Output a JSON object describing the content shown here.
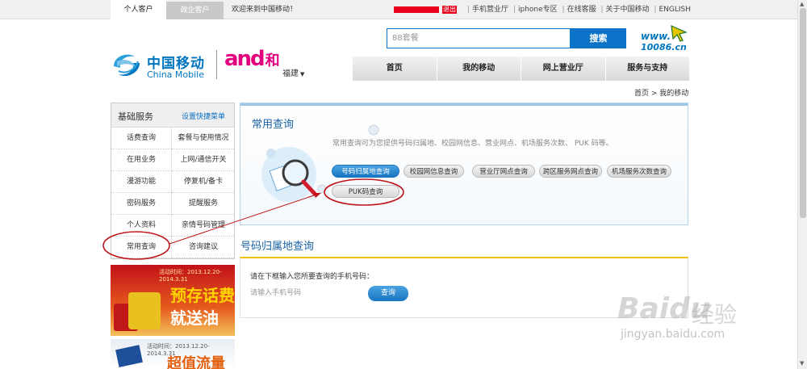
{
  "topbar": {
    "tab_personal": "个人客户",
    "tab_enterprise": "政企客户",
    "welcome": "欢迎来到中国移动！",
    "logout": "退出",
    "links": [
      "手机营业厅",
      "iphone专区",
      "在线客服",
      "关于中国移动",
      "ENGLISH"
    ]
  },
  "header": {
    "brand_cn": "中国移动",
    "brand_en": "China Mobile",
    "and_logo": "and",
    "and_he": "和",
    "region": "福建",
    "search_placeholder": "88套餐",
    "search_button": "搜索",
    "site_www": "www.",
    "site_num": "10086.cn"
  },
  "nav": [
    "首页",
    "我的移动",
    "网上营业厅",
    "服务与支持"
  ],
  "breadcrumb": "首页 > 我的移动",
  "sidebar": {
    "title": "基础服务",
    "set_shortcut": "设置快捷菜单",
    "items": [
      "话费查询",
      "套餐与使用情况",
      "在用业务",
      "上网/通信开关",
      "漫游功能",
      "停复机/备卡",
      "密码服务",
      "提醒服务",
      "个人资料",
      "亲情号码管理",
      "常用查询",
      "咨询建议"
    ]
  },
  "ads": {
    "ad1_date": "活动时间：2013.12.20-2014.3.31",
    "ad1_line1": "预存话费",
    "ad1_line2": "就送油",
    "ad2_date": "活动时间：2013.12.20-2014.3.31",
    "ad2_line1": "超值流量"
  },
  "common_query": {
    "title": "常用查询",
    "desc": "常用查询可为您提供号码归属地、校园网信息、营业网点、机场服务次数、 PUK 码等。",
    "tabs": [
      "号码归属地查询",
      "校园网信息查询",
      "营业厅网点查询",
      "跨区服务网点查询",
      "机场服务次数查询",
      "PUK码查询"
    ],
    "active_tab": "号码归属地查询"
  },
  "number_query": {
    "title": "号码归属地查询",
    "label": "请在下框输入您所要查询的手机号码：",
    "placeholder": "请输入手机号码",
    "button": "查询"
  },
  "watermark": {
    "baidu": "Baidu",
    "jingyan": "经验",
    "url": "jingyan.baidu.com"
  },
  "colors": {
    "brand_blue": "#0a73c8",
    "annotation_red": "#c0141a",
    "and_pink": "#e3007f"
  }
}
